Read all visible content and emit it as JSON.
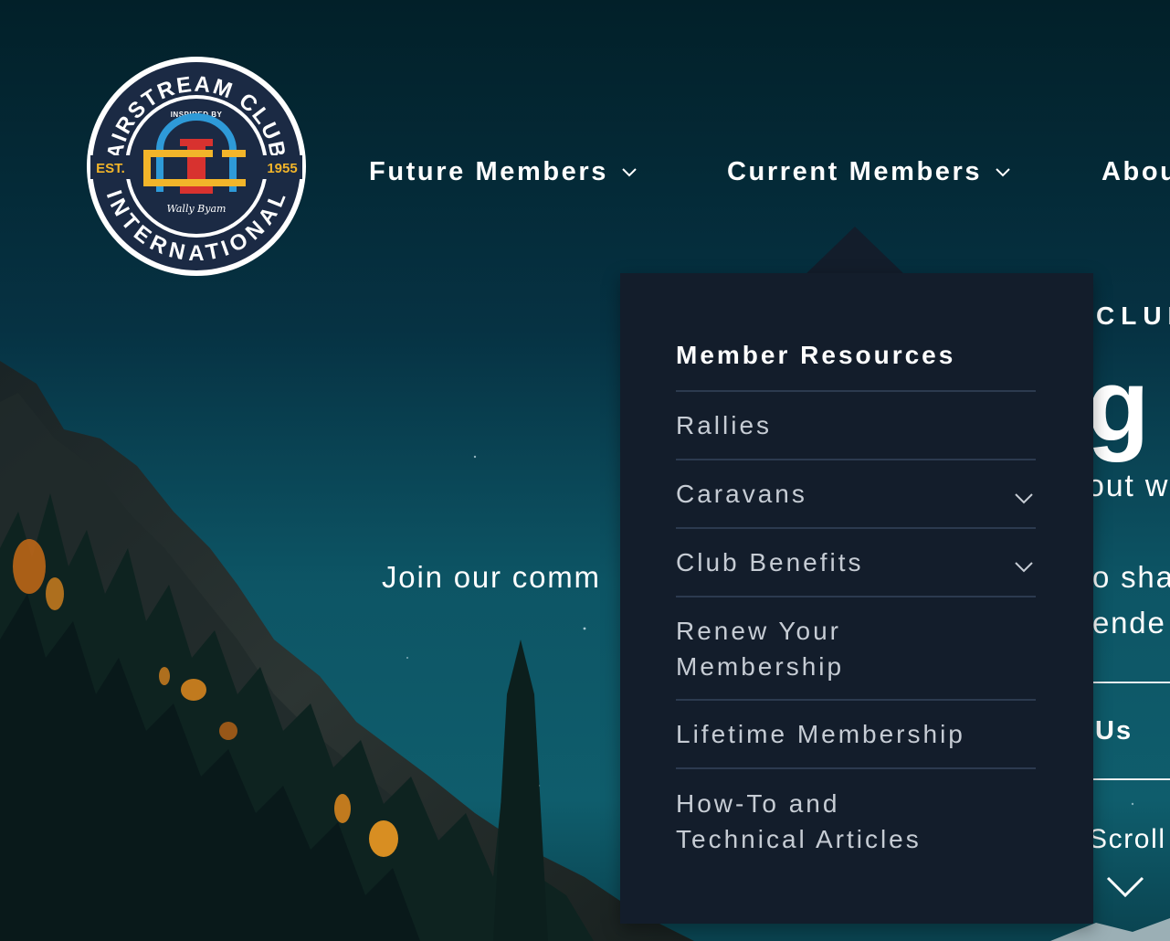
{
  "logo": {
    "top_text": "AIRSTREAM CLUB",
    "bottom_text": "INTERNATIONAL",
    "inspired_by": "INSPIRED BY",
    "est_label": "EST.",
    "year": "1955",
    "signature": "Wally Byam",
    "monogram": "ACI"
  },
  "nav": {
    "items": [
      {
        "label": "Future Members"
      },
      {
        "label": "Current Members"
      },
      {
        "label": "Abou"
      }
    ]
  },
  "hero": {
    "kicker": "CLUB",
    "headline": "g T",
    "sub_line1": "out w",
    "join_text": "Join our comm",
    "sub_line2": "o sha",
    "sub_line3": "ende",
    "cta_label": "Us",
    "scroll_label": "Scroll"
  },
  "dropdown": {
    "heading": "Member Resources",
    "items": [
      {
        "label": "Rallies",
        "has_submenu": false
      },
      {
        "label": "Caravans",
        "has_submenu": true
      },
      {
        "label": "Club Benefits",
        "has_submenu": true
      },
      {
        "label": "Renew Your Membership",
        "has_submenu": false
      },
      {
        "label": "Lifetime Membership",
        "has_submenu": false
      },
      {
        "label": "How-To and Technical Articles",
        "has_submenu": false
      }
    ]
  },
  "colors": {
    "dropdown_bg": "#131d2b",
    "divider": "#2c3a4f",
    "nav_text": "#ffffff",
    "menu_text": "#c6ccd4",
    "logo_navy": "#1b2a44",
    "logo_gold": "#f2b52a",
    "logo_blue": "#2e9ad8",
    "logo_red": "#d8322f"
  }
}
